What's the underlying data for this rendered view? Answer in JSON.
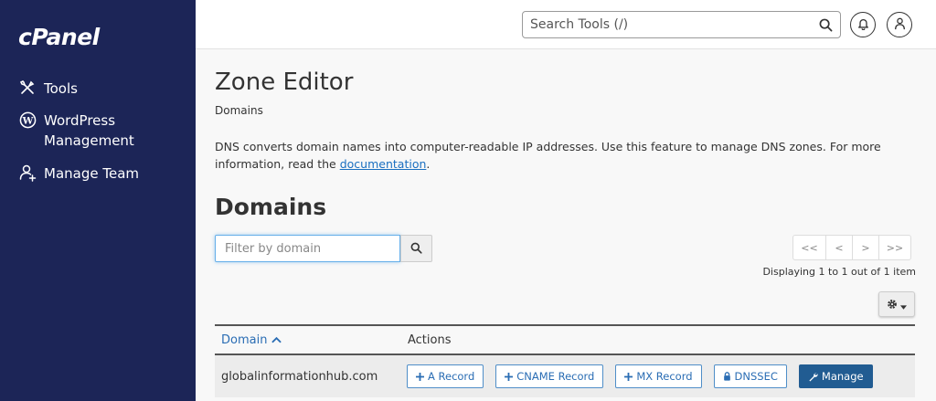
{
  "sidebar": {
    "logo": "cPanel",
    "items": [
      {
        "label_line1": "Tools",
        "label_line2": "",
        "icon": "tools-icon"
      },
      {
        "label_line1": "WordPress",
        "label_line2": "Management",
        "icon": "wordpress-icon"
      },
      {
        "label_line1": "Manage Team",
        "label_line2": "",
        "icon": "user-plus-icon"
      }
    ]
  },
  "header": {
    "search_placeholder": "Search Tools (/)"
  },
  "main": {
    "title": "Zone Editor",
    "breadcrumb": "Domains",
    "description": "DNS converts domain names into computer-readable IP addresses. Use this feature to manage DNS zones. For more information, read the",
    "doc_link": "documentation",
    "period": ".",
    "section_title": "Domains",
    "filter_placeholder": "Filter by domain",
    "pager": [
      "<<",
      "<",
      ">",
      ">>"
    ],
    "displaying": "Displaying 1 to 1 out of 1 item",
    "table": {
      "col_domain": "Domain",
      "col_actions": "Actions",
      "rows": [
        {
          "domain": "globalinformationhub.com",
          "actions": [
            {
              "label": "A Record",
              "icon": "plus-icon"
            },
            {
              "label": "CNAME Record",
              "icon": "plus-icon"
            },
            {
              "label": "MX Record",
              "icon": "plus-icon"
            },
            {
              "label": "DNSSEC",
              "icon": "lock-icon"
            },
            {
              "label": "Manage",
              "icon": "wrench-icon"
            }
          ]
        }
      ]
    }
  },
  "colors": {
    "sidebar_bg": "#1c2557",
    "link_blue": "#1a6fc0",
    "primary_button": "#215c92"
  }
}
